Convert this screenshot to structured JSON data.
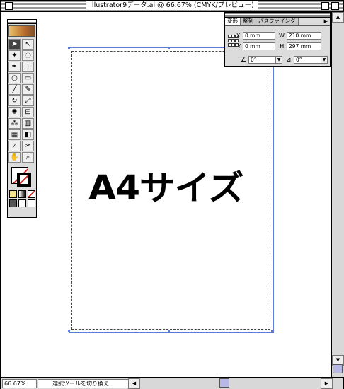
{
  "window": {
    "title": "Illustrator9データ.ai @ 66.67% (CMYK/プレビュー)"
  },
  "artboard": {
    "headline": "A4サイズ"
  },
  "status": {
    "zoom": "66.67%",
    "status_field": "選択ツールを切り換え"
  },
  "palette": {
    "tabs": [
      "変形",
      "整列",
      "パスファインダ"
    ],
    "x": {
      "label": "X:",
      "value": "0 mm"
    },
    "y": {
      "label": "Y:",
      "value": "0 mm"
    },
    "w": {
      "label": "W:",
      "value": "210 mm"
    },
    "h": {
      "label": "H:",
      "value": "297 mm"
    },
    "rotate": {
      "value": "0°"
    },
    "shear": {
      "value": "0°"
    }
  }
}
